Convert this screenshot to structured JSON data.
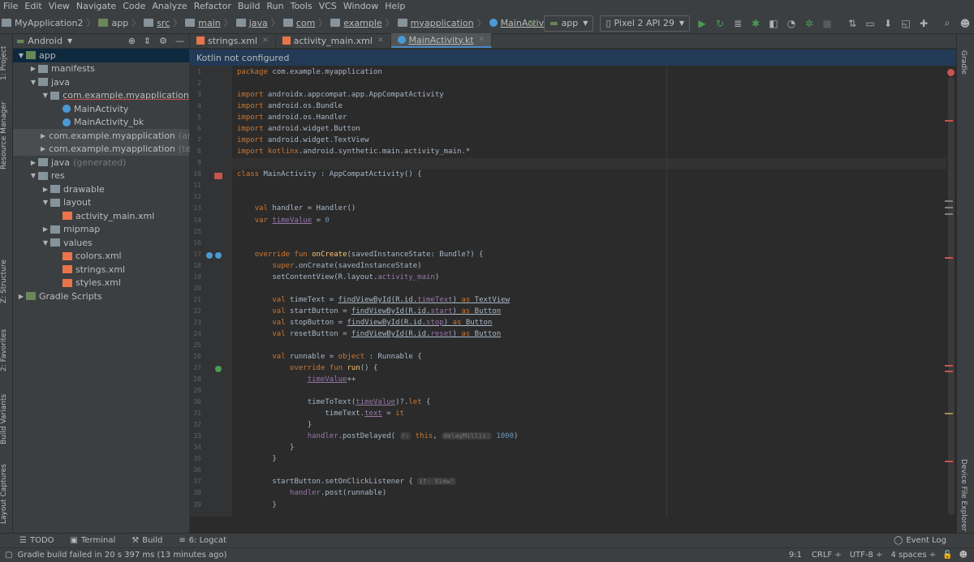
{
  "menu": [
    "File",
    "Edit",
    "View",
    "Navigate",
    "Code",
    "Analyze",
    "Refactor",
    "Build",
    "Run",
    "Tools",
    "VCS",
    "Window",
    "Help"
  ],
  "breadcrumbs": [
    "MyApplication2",
    "app",
    "src",
    "main",
    "java",
    "com",
    "example",
    "myapplication",
    "MainActivity"
  ],
  "toolbar": {
    "run_config": "app",
    "device": "Pixel 2 API 29"
  },
  "project": {
    "view_mode": "Android",
    "tree": [
      {
        "label": "app",
        "suffix": "",
        "indent": 0,
        "arrow": "▼",
        "icon": "module-icon",
        "sel": true
      },
      {
        "label": "manifests",
        "suffix": "",
        "indent": 1,
        "arrow": "▶",
        "icon": "folder-icon"
      },
      {
        "label": "java",
        "suffix": "",
        "indent": 1,
        "arrow": "▼",
        "icon": "folder-icon"
      },
      {
        "label": "com.example.myapplication",
        "suffix": "",
        "indent": 2,
        "arrow": "▼",
        "icon": "package-icon",
        "ul": true
      },
      {
        "label": "MainActivity",
        "suffix": "",
        "indent": 3,
        "arrow": "",
        "icon": "kotlin-class-icon"
      },
      {
        "label": "MainActivity_bk",
        "suffix": "",
        "indent": 3,
        "arrow": "",
        "icon": "kotlin-class-icon"
      },
      {
        "label": "com.example.myapplication",
        "suffix": "(andro",
        "indent": 2,
        "arrow": "▶",
        "icon": "package-icon",
        "hl": true
      },
      {
        "label": "com.example.myapplication",
        "suffix": "(test)",
        "indent": 2,
        "arrow": "▶",
        "icon": "package-icon",
        "hl": true
      },
      {
        "label": "java",
        "suffix": "(generated)",
        "indent": 1,
        "arrow": "▶",
        "icon": "folder-icon"
      },
      {
        "label": "res",
        "suffix": "",
        "indent": 1,
        "arrow": "▼",
        "icon": "folder-icon"
      },
      {
        "label": "drawable",
        "suffix": "",
        "indent": 2,
        "arrow": "▶",
        "icon": "folder-icon"
      },
      {
        "label": "layout",
        "suffix": "",
        "indent": 2,
        "arrow": "▼",
        "icon": "folder-icon"
      },
      {
        "label": "activity_main.xml",
        "suffix": "",
        "indent": 3,
        "arrow": "",
        "icon": "xml-file-icon"
      },
      {
        "label": "mipmap",
        "suffix": "",
        "indent": 2,
        "arrow": "▶",
        "icon": "folder-icon"
      },
      {
        "label": "values",
        "suffix": "",
        "indent": 2,
        "arrow": "▼",
        "icon": "folder-icon"
      },
      {
        "label": "colors.xml",
        "suffix": "",
        "indent": 3,
        "arrow": "",
        "icon": "xml-file-icon"
      },
      {
        "label": "strings.xml",
        "suffix": "",
        "indent": 3,
        "arrow": "",
        "icon": "xml-file-icon"
      },
      {
        "label": "styles.xml",
        "suffix": "",
        "indent": 3,
        "arrow": "",
        "icon": "xml-file-icon"
      },
      {
        "label": "Gradle Scripts",
        "suffix": "",
        "indent": 0,
        "arrow": "▶",
        "icon": "gradle-icon"
      }
    ]
  },
  "left_tabs": [
    "1: Project",
    "Resource Manager",
    "Z: Structure",
    "2: Favorites",
    "Build Variants",
    "Layout Captures"
  ],
  "right_tabs": [
    "Gradle",
    "Device File Explorer"
  ],
  "tabs": [
    {
      "label": "strings.xml",
      "active": false
    },
    {
      "label": "activity_main.xml",
      "active": false
    },
    {
      "label": "MainActivity.kt",
      "active": true
    }
  ],
  "banner": "Kotlin not configured",
  "code_lines": [
    "<span class=\"kw\">package</span> com.example.myapplication",
    "",
    "<span class=\"kw\">import</span> androidx.appcompat.app.AppCompatActivity",
    "<span class=\"kw\">import</span> android.os.Bundle",
    "<span class=\"kw\">import</span> android.os.Handler",
    "<span class=\"kw\">import</span> android.widget.Button",
    "<span class=\"kw\">import</span> android.widget.TextView",
    "<span class=\"kw\">import</span> <span class=\"kw\">kotlinx</span>.android.synthetic.main.activity_main.*",
    "",
    "<span class=\"kw\">class</span> MainActivity : AppCompatActivity() {",
    "",
    "",
    "    <span class=\"kw\">val</span> handler = Handler()",
    "    <span class=\"kw\">var</span> <span class=\"prop uline\">timeValue</span> = <span class=\"num\">0</span>",
    "",
    "",
    "    <span class=\"kw\">override fun</span> <span class=\"fn\">onCreate</span>(savedInstanceState: Bundle?) {",
    "        <span class=\"kw\">super</span>.onCreate(savedInstanceState)",
    "        setContentView(R.layout.<span class=\"prop\">activity_main</span>)",
    "",
    "        <span class=\"kw\">val</span> timeText = <span class=\"uline\">findViewById(R.id.<span class=\"prop\">timeText</span>) <span class=\"kw\">as</span> TextView</span>",
    "        <span class=\"kw\">val</span> startButton = <span class=\"uline\">findViewById(R.id.<span class=\"prop\">start</span>) <span class=\"kw\">as</span> Button</span>",
    "        <span class=\"kw\">val</span> stopButton = <span class=\"uline\">findViewById(R.id.<span class=\"prop\">stop</span>) <span class=\"kw\">as</span> Button</span>",
    "        <span class=\"kw\">val</span> resetButton = <span class=\"uline\">findViewById(R.id.<span class=\"prop\">reset</span>) <span class=\"kw\">as</span> Button</span>",
    "",
    "        <span class=\"kw\">val</span> runnable = <span class=\"kw\">object</span> : Runnable {",
    "            <span class=\"kw\">override fun</span> <span class=\"fn\">run</span>() {",
    "                <span class=\"prop uline\">timeValue</span>++",
    "",
    "                timeToText(<span class=\"prop uline\">timeValue</span>)?.<span class=\"kw\">let</span> {",
    "                    timeText.<span class=\"prop uline\">text</span> = <span class=\"kw\">it</span>",
    "                }",
    "                <span class=\"prop\">handler</span>.postDelayed( <span class=\"hint\">r:</span> <span class=\"kw\">this</span>, <span class=\"hint\">delayMillis:</span> <span class=\"num\">1000</span>)",
    "            }",
    "        }",
    "",
    "        startButton.setOnClickListener { <span class=\"hint\">it: View!</span>",
    "            <span class=\"prop\">handler</span>.post(runnable)",
    "        }"
  ],
  "bottom_tools": [
    {
      "icon": "list-icon",
      "label": "TODO",
      "underline": ""
    },
    {
      "icon": "terminal-icon",
      "label": "Terminal",
      "underline": ""
    },
    {
      "icon": "hammer-icon",
      "label": "Build",
      "underline": ""
    },
    {
      "icon": "logcat-icon",
      "label": "6: Logcat",
      "underline": ""
    }
  ],
  "event_log": "Event Log",
  "status": {
    "message": "Gradle build failed in 20 s 397 ms (13 minutes ago)",
    "position": "9:1",
    "line_sep": "CRLF ÷",
    "encoding": "UTF-8 ÷",
    "indent": "4 spaces ÷"
  },
  "colors": {
    "accent": "#4a88c7",
    "error": "#c75450",
    "keyword": "#cc7832",
    "string": "#6a8759",
    "number": "#6897bb"
  }
}
